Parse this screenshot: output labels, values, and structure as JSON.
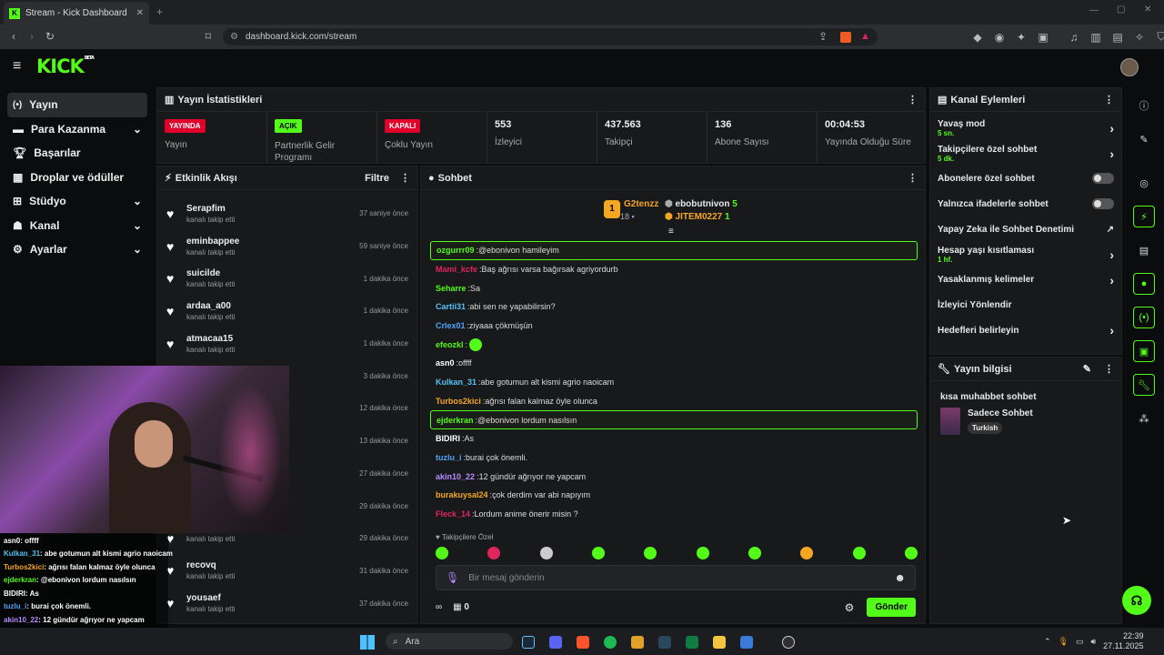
{
  "browser": {
    "tab_title": "Stream - Kick Dashboard",
    "url": "dashboard.kick.com/stream"
  },
  "header": {
    "logo": "KICK",
    "beta": "BETA"
  },
  "sidebar": {
    "items": [
      {
        "label": "Yayın",
        "icon": "broadcast-icon",
        "active": true,
        "chevron": false
      },
      {
        "label": "Para Kazanma",
        "icon": "money-icon",
        "chevron": true
      },
      {
        "label": "Başarılar",
        "icon": "trophy-icon",
        "chevron": false
      },
      {
        "label": "Droplar ve ödüller",
        "icon": "gift-icon",
        "chevron": false
      },
      {
        "label": "Stüdyo",
        "icon": "studio-icon",
        "chevron": true
      },
      {
        "label": "Kanal",
        "icon": "people-icon",
        "chevron": true
      },
      {
        "label": "Ayarlar",
        "icon": "gear-icon",
        "chevron": true
      }
    ]
  },
  "stats": {
    "title": "Yayın İstatistikleri",
    "cells": [
      {
        "badge": "YAYINDA",
        "badge_color": "#e0002a",
        "label": "Yayın"
      },
      {
        "badge": "AÇIK",
        "badge_color": "#53fc18",
        "label": "Partnerlik Gelir Programı"
      },
      {
        "badge": "KAPALI",
        "badge_color": "#e0002a",
        "label": "Çoklu Yayın"
      },
      {
        "value": "553",
        "label": "İzleyici"
      },
      {
        "value": "437.563",
        "label": "Takipçi"
      },
      {
        "value": "136",
        "label": "Abone Sayısı"
      },
      {
        "value": "00:04:53",
        "label": "Yayında Olduğu Süre"
      }
    ]
  },
  "activity": {
    "title": "Etkinlik Akışı",
    "filter": "Filtre",
    "items": [
      {
        "name": "Serapfim",
        "action": "kanalı takip etti",
        "time": "37 saniye önce"
      },
      {
        "name": "eminbappee",
        "action": "kanalı takip etti",
        "time": "59 saniye önce"
      },
      {
        "name": "suicilde",
        "action": "kanalı takip etti",
        "time": "1 dakika önce"
      },
      {
        "name": "ardaa_a00",
        "action": "kanalı takip etti",
        "time": "1 dakika önce"
      },
      {
        "name": "atmacaa15",
        "action": "kanalı takip etti",
        "time": "1 dakika önce"
      },
      {
        "name": "",
        "action": "",
        "time": "3 dakika önce"
      },
      {
        "name": "",
        "action": "",
        "time": "12 dakika önce"
      },
      {
        "name": "",
        "action": "",
        "time": "13 dakika önce"
      },
      {
        "name": "",
        "action": "",
        "time": "27 dakika önce"
      },
      {
        "name": "",
        "action": "",
        "time": "29 dakika önce"
      },
      {
        "name": "",
        "action": "kanalı takip etti",
        "time": "29 dakika önce"
      },
      {
        "name": "recovq",
        "action": "kanalı takip etti",
        "time": "31 dakika önce"
      },
      {
        "name": "yousaef",
        "action": "kanalı takip etti",
        "time": "37 dakika önce"
      }
    ]
  },
  "chat": {
    "title": "Sohbet",
    "top": [
      {
        "rank": "1",
        "name": "G2tenzz",
        "count": "18"
      },
      {
        "name": "ebobutnivon",
        "count": "5"
      },
      {
        "name": "JITEM0227",
        "count": "1"
      }
    ],
    "messages": [
      {
        "user": "ozgurrr09",
        "color": "#53fc18",
        "text": "@ebonivon hamileyim",
        "highlight": true
      },
      {
        "user": "Mami_kcfe",
        "color": "#e0245e",
        "text": "Baş ağrısı varsa bağırsak agriyordurb"
      },
      {
        "user": "Seharre",
        "color": "#53fc18",
        "text": "Sa"
      },
      {
        "user": "Cartii31",
        "color": "#4fc3f7",
        "text": "abi sen ne yapabilirsin?"
      },
      {
        "user": "Crlex01",
        "color": "#4fa3f7",
        "text": "ziyaaa çökmüşün"
      },
      {
        "user": "efeozkl",
        "color": "#53fc18",
        "text": "",
        "emote": true
      },
      {
        "user": "asn0",
        "color": "#ffffff",
        "text": "offff"
      },
      {
        "user": "Kulkan_31",
        "color": "#4fc3f7",
        "text": "abe gotumun alt kismi agrio naoicam"
      },
      {
        "user": "Turbos2kici",
        "color": "#f5a623",
        "text": "ağrısı falan kalmaz öyle olunca"
      },
      {
        "user": "ejderkran",
        "color": "#53fc18",
        "text": "@ebonivon lordum nasılsın",
        "highlight": true
      },
      {
        "user": "BIDIRI",
        "color": "#ffffff",
        "text": "As"
      },
      {
        "user": "tuzlu_i",
        "color": "#4fa3f7",
        "text": "burai çok önemli."
      },
      {
        "user": "akin10_22",
        "color": "#b68cff",
        "text": "12 gündür ağrıyor ne yapcam"
      },
      {
        "user": "burakuysal24",
        "color": "#f5a623",
        "text": "çok derdim var abi napıyım"
      },
      {
        "user": "Fleck_14",
        "color": "#e0245e",
        "text": "Lordum anime önerir misin ?"
      }
    ],
    "followers_only": "Takipçilere Özel",
    "placeholder": "Bir mesaj gönderin",
    "send": "Gönder",
    "pinned_count": "0"
  },
  "channel_actions": {
    "title": "Kanal Eylemleri",
    "items": [
      {
        "label": "Yavaş mod",
        "sub": "5 sn.",
        "type": "chevron"
      },
      {
        "label": "Takipçilere özel sohbet",
        "sub": "5 dk.",
        "type": "chevron"
      },
      {
        "label": "Abonelere özel sohbet",
        "sub": "",
        "type": "toggle"
      },
      {
        "label": "Yalnızca ifadelerle sohbet",
        "sub": "",
        "type": "toggle"
      },
      {
        "label": "Yapay Zeka ile Sohbet Denetimi",
        "sub": "",
        "type": "external"
      },
      {
        "label": "Hesap yaşı kısıtlaması",
        "sub": "1 hf.",
        "type": "chevron"
      },
      {
        "label": "Yasaklanmış kelimeler",
        "sub": "",
        "type": "chevron"
      },
      {
        "label": "İzleyici Yönlendir",
        "sub": "",
        "type": "none"
      },
      {
        "label": "Hedefleri belirleyin",
        "sub": "",
        "type": "chevron"
      }
    ]
  },
  "stream_info": {
    "title": "Yayın bilgisi",
    "stream_title": "kısa muhabbet sohbet",
    "category": "Sadece Sohbet",
    "tag": "Turkish"
  },
  "overlay_chat": [
    {
      "user": "asn0",
      "text": " : offff",
      "color": "#ffffff"
    },
    {
      "user": "Kulkan_31",
      "text": " : abe gotumun alt kismi agrio naoicam",
      "color": "#4fc3f7"
    },
    {
      "user": "Turbos2kici",
      "text": " : ağrısı falan kalmaz öyle olunca",
      "color": "#f5a623"
    },
    {
      "user": "ejderkran",
      "text": " : @ebonivon lordum nasılsın",
      "color": "#53fc18"
    },
    {
      "user": "BIDIRI",
      "text": " : As",
      "color": "#ffffff"
    },
    {
      "user": "tuzlu_i",
      "text": " : burai çok önemli.",
      "color": "#4fa3f7"
    },
    {
      "user": "akin10_22",
      "text": " : 12 gündür ağrıyor ne yapcam",
      "color": "#b68cff"
    },
    {
      "user": "burakuysal24",
      "text": " : çok derdim var abi napıyım",
      "color": "#f5a623"
    },
    {
      "user": "Fleck_14",
      "text": " : Lordum anime önerir misin ?",
      "color": "#e0245e"
    }
  ],
  "taskbar": {
    "search": "Ara",
    "time": "22:39",
    "date": "27.11.2025"
  },
  "colors": {
    "accent": "#53fc18",
    "live": "#e0002a",
    "bg": "#0b0c0d",
    "panel": "#18191b"
  }
}
